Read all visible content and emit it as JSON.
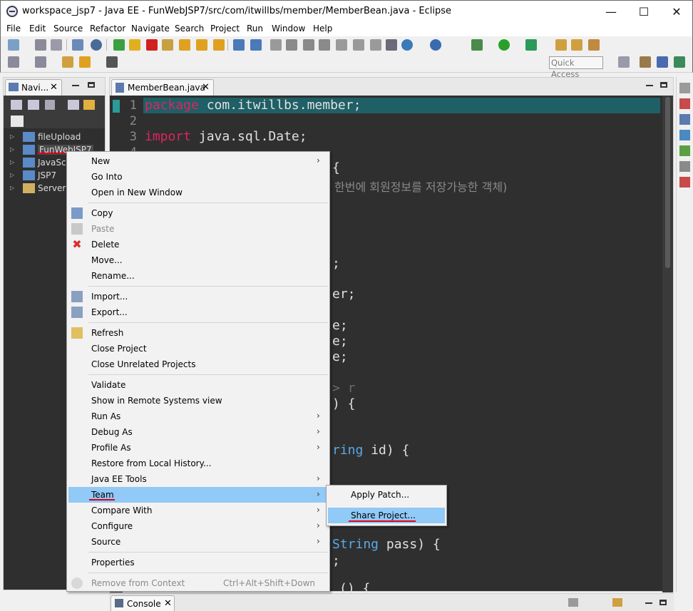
{
  "window": {
    "title": "workspace_jsp7 - Java EE - FunWebJSP7/src/com/itwillbs/member/MemberBean.java - Eclipse",
    "minimize": "—",
    "maximize": "☐",
    "close": "✕"
  },
  "menubar": [
    "File",
    "Edit",
    "Source",
    "Refactor",
    "Navigate",
    "Search",
    "Project",
    "Run",
    "Window",
    "Help"
  ],
  "toolbar": {
    "quick_access": "Quick Access"
  },
  "navigator": {
    "tab_label": "Navi...",
    "items": [
      {
        "label": "fileUpload"
      },
      {
        "label": "FunWebJSP7"
      },
      {
        "label": "JavaScri"
      },
      {
        "label": "JSP7"
      },
      {
        "label": "Servers"
      }
    ]
  },
  "editor": {
    "tab_label": "MemberBean.java",
    "tab_close": "✕",
    "lines": [
      {
        "num": "1",
        "kw": "package",
        "rest": " com.itwillbs.member;"
      },
      {
        "num": "2"
      },
      {
        "num": "3",
        "kw": "import",
        "rest": " java.sql.Date;"
      },
      {
        "num": "4"
      }
    ],
    "fragments": {
      "brace1": "{",
      "comment": "한번에 회원정보를 저장가능한 객체)",
      "semi1": ";",
      "er": "er;",
      "e1": "e;",
      "e2": "e;",
      "e3": "e;",
      "gt_r": "> r",
      "paren_brace": ") {",
      "string_type": "ring",
      "id_param": " id) {",
      "string_type2": "String",
      "pass_param": " pass) {",
      "semi2": ";",
      "tail": "() {"
    }
  },
  "console": {
    "tab_label": "Console",
    "tab_close": "✕"
  },
  "context_menu": {
    "items": [
      {
        "label": "New",
        "submenu": true
      },
      {
        "label": "Go Into"
      },
      {
        "label": "Open in New Window"
      },
      {
        "label": "Copy"
      },
      {
        "label": "Paste",
        "disabled": true
      },
      {
        "label": "Delete"
      },
      {
        "label": "Move..."
      },
      {
        "label": "Rename..."
      },
      {
        "label": "Import..."
      },
      {
        "label": "Export..."
      },
      {
        "label": "Refresh"
      },
      {
        "label": "Close Project"
      },
      {
        "label": "Close Unrelated Projects"
      },
      {
        "label": "Validate"
      },
      {
        "label": "Show in Remote Systems view"
      },
      {
        "label": "Run As",
        "submenu": true
      },
      {
        "label": "Debug As",
        "submenu": true
      },
      {
        "label": "Profile As",
        "submenu": true
      },
      {
        "label": "Restore from Local History..."
      },
      {
        "label": "Java EE Tools",
        "submenu": true
      },
      {
        "label": "Team",
        "submenu": true,
        "highlighted": true
      },
      {
        "label": "Compare With",
        "submenu": true
      },
      {
        "label": "Configure",
        "submenu": true
      },
      {
        "label": "Source",
        "submenu": true
      },
      {
        "label": "Properties"
      },
      {
        "label": "Remove from Context",
        "accelerator": "Ctrl+Alt+Shift+Down",
        "disabled": true
      }
    ],
    "submenu_arrow": "›"
  },
  "team_submenu": {
    "items": [
      {
        "label": "Apply Patch..."
      },
      {
        "label": "Share Project...",
        "highlighted": true
      }
    ]
  },
  "colors": {
    "highlight": "#91c9f7",
    "keyword": "#e0245e",
    "type": "#5aa9e6",
    "annotation_underline": "#e0001a"
  }
}
